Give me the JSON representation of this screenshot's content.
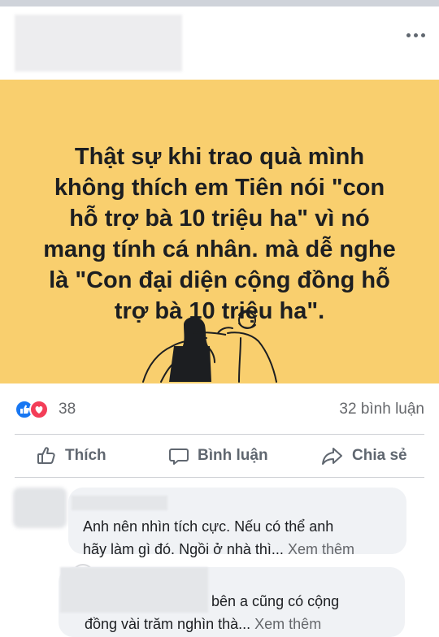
{
  "post": {
    "text": "Thật sự khi trao quà mình\nkhông thích em Tiên nói \"con\nhỗ trợ bà 10 triệu ha\" vì nó\nmang tính cá nhân. mà dễ nghe\nlà \"Con đại diện cộng đồng hỗ\ntrợ bà 10 triệu ha\".",
    "background_color": "#f9cf6e"
  },
  "reactions": {
    "count": "38",
    "icons": [
      "like-icon",
      "love-icon"
    ]
  },
  "comments_count": "32 bình luận",
  "actions": {
    "like": "Thích",
    "comment": "Bình luận",
    "share": "Chia sẻ"
  },
  "comments": [
    {
      "line1": "Anh nên nhìn tích cực. Nếu có thể anh",
      "line2": "hãy làm gì đó. Ngồi ở nhà thì...",
      "see_more": "Xem thêm"
    },
    {
      "line1": "bên a cũng có cộng",
      "line2": "đồng vài trăm nghìn thà...",
      "see_more": "Xem thêm"
    }
  ],
  "colors": {
    "accent": "#1877f2",
    "love": "#f33e58",
    "muted_text": "#65676b"
  }
}
